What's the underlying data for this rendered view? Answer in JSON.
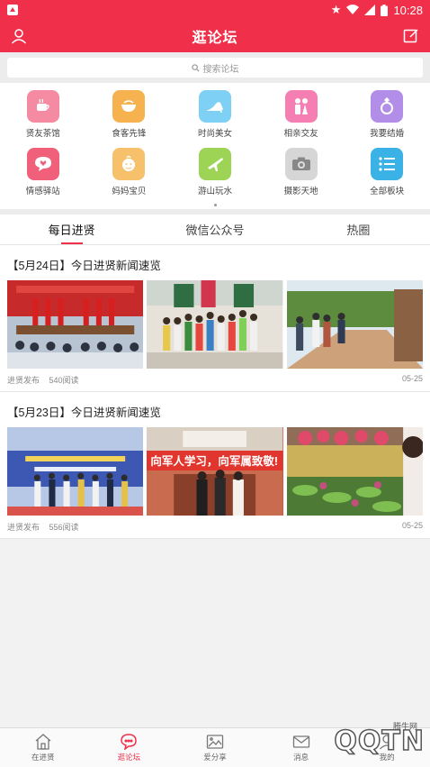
{
  "status": {
    "time": "10:28"
  },
  "header": {
    "title": "逛论坛"
  },
  "search": {
    "placeholder": "搜索论坛"
  },
  "grid": [
    {
      "label": "贤友茶馆",
      "icon": "tea-cup-icon",
      "color": "#f58ba3"
    },
    {
      "label": "食客先锋",
      "icon": "bowl-icon",
      "color": "#f6b24f"
    },
    {
      "label": "时尚美女",
      "icon": "high-heel-icon",
      "color": "#7fd0f5"
    },
    {
      "label": "相亲交友",
      "icon": "couple-icon",
      "color": "#f57fb3"
    },
    {
      "label": "我要结婚",
      "icon": "ring-icon",
      "color": "#b38ee8"
    },
    {
      "label": "情感驿站",
      "icon": "chat-heart-icon",
      "color": "#f0607a"
    },
    {
      "label": "妈妈宝贝",
      "icon": "baby-icon",
      "color": "#f7c06a"
    },
    {
      "label": "游山玩水",
      "icon": "plane-icon",
      "color": "#9dd455"
    },
    {
      "label": "摄影天地",
      "icon": "camera-icon",
      "color": "#bdbdbd"
    },
    {
      "label": "全部板块",
      "icon": "list-icon",
      "color": "#3ab2e6"
    }
  ],
  "tabs": [
    "每日进贤",
    "微信公众号",
    "热圈"
  ],
  "posts": [
    {
      "title": "【5月24日】今日进贤新闻速览",
      "source": "进贤发布",
      "reads": "540阅读",
      "date": "05-25"
    },
    {
      "title": "【5月23日】今日进贤新闻速览",
      "source": "进贤发布",
      "reads": "556阅读",
      "date": "05-25"
    }
  ],
  "photo_text": {
    "banner1": "向军人学习，向军属致敬!",
    "watermark_logo": "QQTN",
    "watermark_site": "腾牛网"
  },
  "bottom_nav": [
    "在进贤",
    "逛论坛",
    "爱分享",
    "消息",
    "我的"
  ]
}
